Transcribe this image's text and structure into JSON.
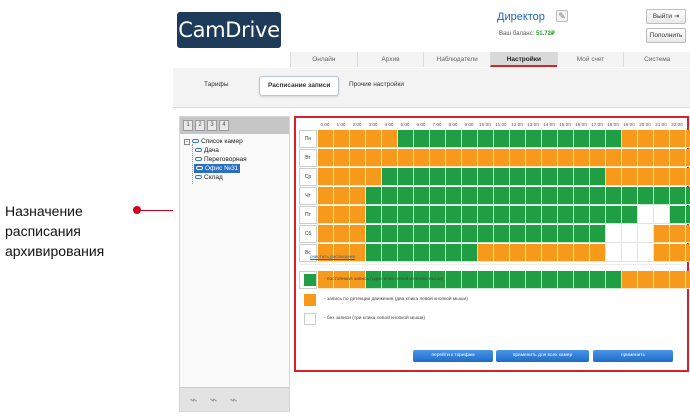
{
  "annotation": {
    "lines": [
      "Назначение",
      "расписания",
      "архивирования"
    ]
  },
  "header": {
    "logo": "CamDrive",
    "user_name": "Директор",
    "balance_label": "Ваш баланс:",
    "balance_value": "51.72₽",
    "exit_label": "Выйти",
    "topup_label": "Пополнить"
  },
  "main_tabs": [
    {
      "label": "Онлайн",
      "active": false
    },
    {
      "label": "Архив",
      "active": false
    },
    {
      "label": "Наблюдатели",
      "active": false
    },
    {
      "label": "Настройки",
      "active": true
    },
    {
      "label": "Мой счет",
      "active": false
    },
    {
      "label": "Система",
      "active": false
    }
  ],
  "sub_tabs": [
    {
      "label": "Тарифы",
      "active": false
    },
    {
      "label": "Расписание записи",
      "active": true
    },
    {
      "label": "Прочие настройки",
      "active": false
    }
  ],
  "sidebar": {
    "pages": [
      "1",
      "2",
      "3",
      "4"
    ],
    "tree_root": "Список камер",
    "cameras": [
      {
        "label": "Дача",
        "selected": false
      },
      {
        "label": "Переговорная",
        "selected": false
      },
      {
        "label": "Офис №31",
        "selected": true
      },
      {
        "label": "Склад",
        "selected": false
      }
    ],
    "tools": [
      "camera-add-icon",
      "camera-edit-icon",
      "camera-delete-icon"
    ]
  },
  "schedule": {
    "hours": [
      "0:00",
      "1:00",
      "2:00",
      "3:00",
      "4:00",
      "5:00",
      "6:00",
      "7:00",
      "8:00",
      "9:00",
      "10:00",
      "11:00",
      "12:00",
      "13:00",
      "14:00",
      "15:00",
      "16:00",
      "17:00",
      "18:00",
      "19:00",
      "20:00",
      "21:00",
      "22:00",
      "23:00"
    ],
    "rows": [
      {
        "day": "Пн",
        "cells": "oooooggggggggggggggoooo o"
      },
      {
        "day": "Вт",
        "cells": "ooooooooooooooooooooooo"
      },
      {
        "day": "Ср",
        "cells": "ooooggggggggggggggoooooo"
      },
      {
        "day": "Чт",
        "cells": "oooggggggggggggggggggggg"
      },
      {
        "day": "Пт",
        "cells": "ooogggggggggggggggggwwgg"
      },
      {
        "day": "Сб",
        "cells": "ooogggggggggggggggwwwooo"
      },
      {
        "day": "Вс",
        "cells": "ooogggggggoooooooowwwooo"
      }
    ],
    "all_days_label": "все дни",
    "all_days_cells": "oooggggggggggggggggooooo",
    "clear_link": "очистить расписание",
    "legend": [
      {
        "color": "#1f9e44",
        "text": "- постоянная запись (один клик левой кнопкой мыши)"
      },
      {
        "color": "#f79a1c",
        "text": "- запись по детекции движения (два клика левой кнопкой мыши)"
      },
      {
        "color": "#ffffff",
        "text": "- без записи (три клика левой кнопкой мыши)"
      }
    ],
    "buttons": {
      "go_tariffs": "перейти к тарифам",
      "apply_all": "применить для всех камер",
      "apply": "применить"
    },
    "colors": {
      "continuous": "#1f9e44",
      "motion": "#f79a1c",
      "none": "#ffffff",
      "highlight": "#d8202a"
    }
  }
}
